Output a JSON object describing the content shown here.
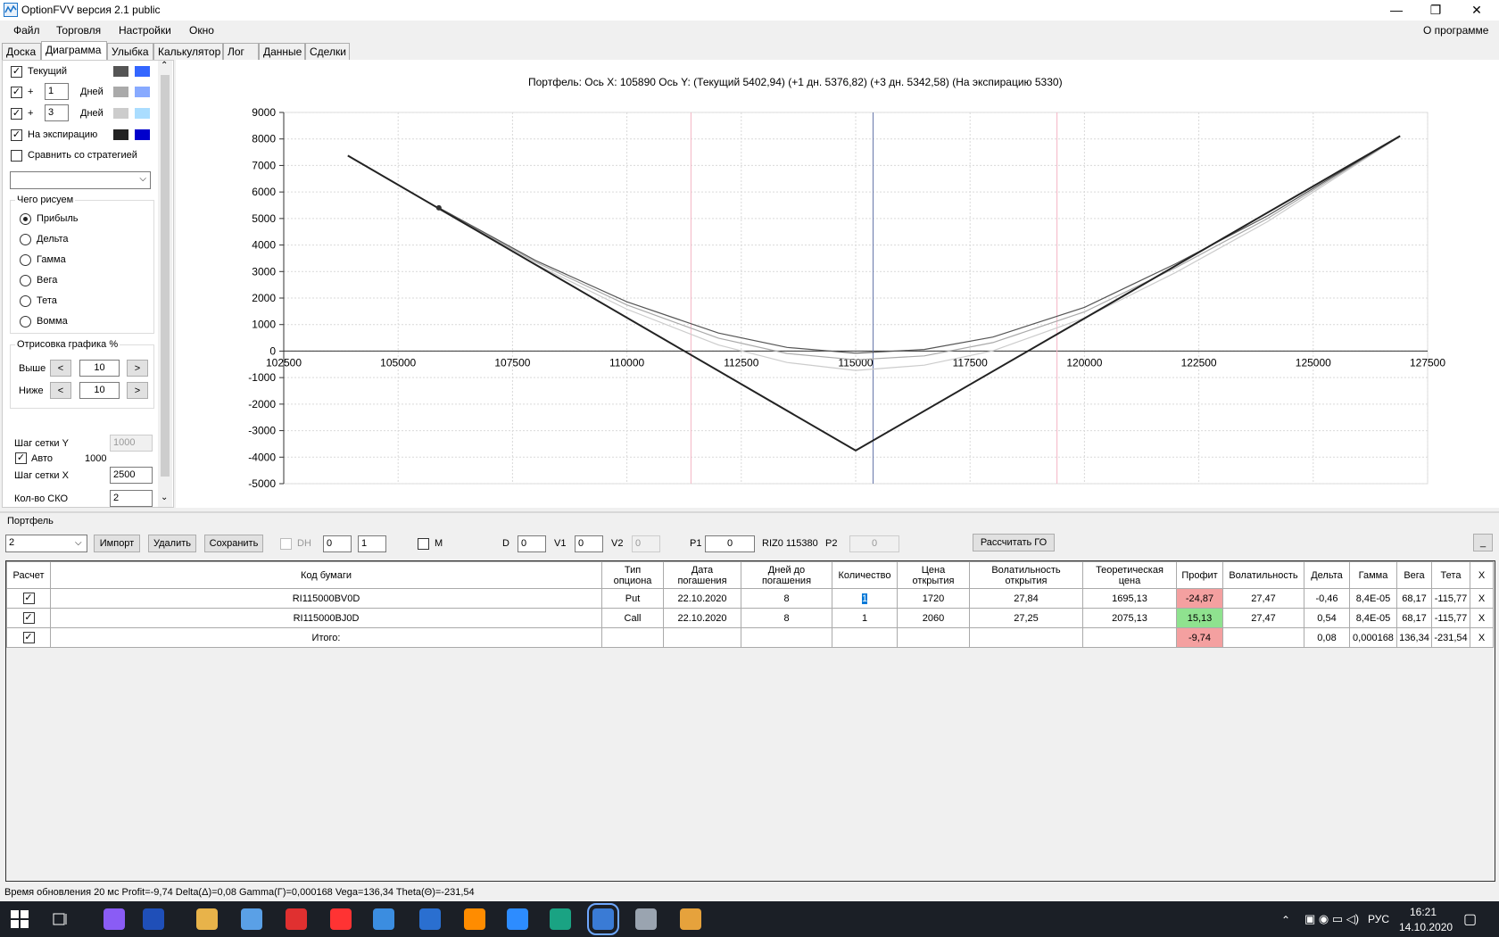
{
  "window": {
    "title": "OptionFVV версия 2.1 public",
    "minimize": "—",
    "restore": "❐",
    "close": "✕"
  },
  "menu": {
    "items": [
      "Файл",
      "Торговля",
      "Настройки",
      "Окно"
    ],
    "about": "О программе"
  },
  "tabs": [
    "Доска",
    "Диаграмма",
    "Улыбка",
    "Калькулятор",
    "Лог",
    "Данные",
    "Сделки"
  ],
  "left_panel": {
    "current_label": "Текущий",
    "plus": "+",
    "days": "Дней",
    "day1_value": "1",
    "day3_value": "3",
    "expiry_label": "На экспирацию",
    "compare_label": "Сравнить со стратегией",
    "draw_group": "Чего рисуем",
    "draw_options": [
      "Прибыль",
      "Дельта",
      "Гамма",
      "Вега",
      "Тета",
      "Вомма"
    ],
    "draw_selected": "Прибыль",
    "plot_group": "Отрисовка графика %",
    "above_label": "Выше",
    "below_label": "Ниже",
    "above_value": "10",
    "below_value": "10",
    "prev": "<",
    "next": ">",
    "grid_y_label": "Шаг сетки Y",
    "grid_y_value": "1000",
    "auto_label": "Авто",
    "auto_value": "1000",
    "grid_x_label": "Шаг сетки X",
    "grid_x_value": "2500",
    "sko_label": "Кол-во СКО",
    "sko_value": "2",
    "colors": {
      "current": [
        "#555555",
        "#3366ff"
      ],
      "day1": [
        "#aaaaaa",
        "#88aaff"
      ],
      "day3": [
        "#cccccc",
        "#aaddff"
      ],
      "expiry": [
        "#222222",
        "#0000cc"
      ]
    }
  },
  "chart_title": "Портфель: Ось X: 105890 Ось Y:  (Текущий 5402,94)  (+1 дн. 5376,82)  (+3 дн. 5342,58)  (На экспирацию 5330)",
  "chart_data": {
    "type": "line",
    "xlim": [
      102500,
      127500
    ],
    "ylim": [
      -5000,
      9000
    ],
    "x_ticks": [
      "102500",
      "105000",
      "107500",
      "110000",
      "112500",
      "115000",
      "117500",
      "120000",
      "122500",
      "125000",
      "127500"
    ],
    "y_ticks": [
      "9000",
      "8000",
      "7000",
      "6000",
      "5000",
      "4000",
      "3000",
      "2000",
      "1000",
      "0",
      "-1000",
      "-2000",
      "-3000",
      "-4000",
      "-5000"
    ],
    "grid": true,
    "vertical_markers": [
      {
        "x": 111400,
        "color": "#f4b4c4"
      },
      {
        "x": 115380,
        "color": "#6677aa"
      },
      {
        "x": 119400,
        "color": "#f4b4c4"
      }
    ],
    "series": [
      {
        "color": "#222222",
        "points": [
          [
            103900,
            7370
          ],
          [
            115000,
            -3750
          ],
          [
            126900,
            8110
          ]
        ]
      },
      {
        "color": "#555555",
        "points": [
          [
            105900,
            5400
          ],
          [
            108000,
            3420
          ],
          [
            110000,
            1860
          ],
          [
            112000,
            680
          ],
          [
            113500,
            140
          ],
          [
            115000,
            -80
          ],
          [
            116500,
            60
          ],
          [
            118000,
            530
          ],
          [
            120000,
            1650
          ],
          [
            122000,
            3300
          ],
          [
            124000,
            5100
          ],
          [
            126900,
            8100
          ]
        ]
      },
      {
        "color": "#aaaaaa",
        "points": [
          [
            105900,
            5380
          ],
          [
            108000,
            3360
          ],
          [
            110000,
            1740
          ],
          [
            112000,
            490
          ],
          [
            113500,
            -90
          ],
          [
            115000,
            -330
          ],
          [
            116500,
            -180
          ],
          [
            118000,
            320
          ],
          [
            120000,
            1480
          ],
          [
            122000,
            3150
          ],
          [
            124000,
            5000
          ],
          [
            126900,
            8100
          ]
        ]
      },
      {
        "color": "#cccccc",
        "points": [
          [
            105900,
            5340
          ],
          [
            108000,
            3280
          ],
          [
            110000,
            1580
          ],
          [
            112000,
            230
          ],
          [
            113500,
            -430
          ],
          [
            115000,
            -730
          ],
          [
            116500,
            -530
          ],
          [
            118000,
            10
          ],
          [
            120000,
            1250
          ],
          [
            122000,
            2970
          ],
          [
            124000,
            4880
          ],
          [
            126900,
            8100
          ]
        ]
      }
    ],
    "marker": {
      "x": 105890,
      "y": 5402.94
    }
  },
  "portfolio": {
    "label": "Портфель",
    "select_value": "2",
    "import": "Импорт",
    "delete": "Удалить",
    "save": "Сохранить",
    "dh": "DH",
    "spin1": "0",
    "spin2": "1",
    "m": "M",
    "d_label": "D",
    "d_value": "0",
    "v1_label": "V1",
    "v1_value": "0",
    "v2_label": "V2",
    "v2_value": "0",
    "p1_label": "P1",
    "p1_value": "0",
    "riz": "RIZ0 115380",
    "p2_label": "P2",
    "p2_value": "0",
    "calc": "Рассчитать ГО",
    "minimize": "_"
  },
  "table": {
    "headers": [
      [
        "Расчет"
      ],
      [
        "Код бумаги"
      ],
      [
        "Тип",
        "опциона"
      ],
      [
        "Дата",
        "погашения"
      ],
      [
        "Дней до",
        "погашения"
      ],
      [
        "Количество"
      ],
      [
        "Цена",
        "открытия"
      ],
      [
        "Волатильность",
        "открытия"
      ],
      [
        "Теоретическая",
        "цена"
      ],
      [
        "Профит"
      ],
      [
        "Волатильность"
      ],
      [
        "Дельта"
      ],
      [
        "Гамма"
      ],
      [
        "Вега"
      ],
      [
        "Тета"
      ],
      [
        "X"
      ]
    ],
    "rows": [
      {
        "code": "RI115000BV0D",
        "type": "Put",
        "date": "22.10.2020",
        "days": "8",
        "qty": "1",
        "price": "1720",
        "vol_open": "27,84",
        "theo": "1695,13",
        "profit": "-24,87",
        "vol": "27,47",
        "delta": "-0,46",
        "gamma": "8,4E-05",
        "vega": "68,17",
        "theta": "-115,77",
        "x": "X"
      },
      {
        "code": "RI115000BJ0D",
        "type": "Call",
        "date": "22.10.2020",
        "days": "8",
        "qty": "1",
        "price": "2060",
        "vol_open": "27,25",
        "theo": "2075,13",
        "profit": "15,13",
        "vol": "27,47",
        "delta": "0,54",
        "gamma": "8,4E-05",
        "vega": "68,17",
        "theta": "-115,77",
        "x": "X"
      }
    ],
    "total": {
      "label": "Итого:",
      "profit": "-9,74",
      "delta": "0,08",
      "gamma": "0,000168",
      "vega": "136,34",
      "theta": "-231,54",
      "x": "X"
    }
  },
  "status": "Время обновления 20 мс   Profit=-9,74 Delta(Δ)=0,08 Gamma(Γ)=0,000168 Vega=136,34 Theta(Θ)=-231,54",
  "taskbar": {
    "lang": "РУС",
    "time": "16:21",
    "date": "14.10.2020",
    "icons": [
      "windows-start",
      "task-view",
      "alice",
      "save-app",
      "file-explorer",
      "network-app",
      "yandex-browser",
      "yandex",
      "chrome",
      "thunderbird",
      "vlc",
      "zoom",
      "qlik",
      "optionfvv",
      "files",
      "media-player"
    ]
  }
}
